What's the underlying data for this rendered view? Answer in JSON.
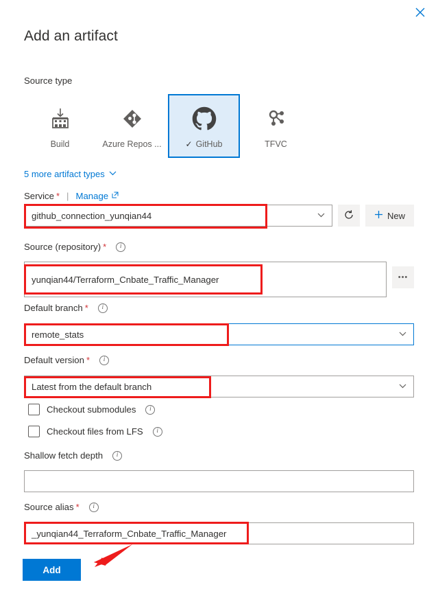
{
  "dialog": {
    "title": "Add an artifact",
    "close_label": "✕"
  },
  "source_type": {
    "label": "Source type",
    "tiles": [
      {
        "label": "Build",
        "icon": "build-icon",
        "selected": false
      },
      {
        "label": "Azure Repos ...",
        "icon": "azure-repos-icon",
        "selected": false
      },
      {
        "label": "GitHub",
        "icon": "github-icon",
        "selected": true
      },
      {
        "label": "TFVC",
        "icon": "tfvc-icon",
        "selected": false
      }
    ],
    "more_types_link": "5 more artifact types",
    "more_types_chevron": "⌄"
  },
  "service": {
    "label": "Service",
    "required_mark": "*",
    "separator": "|",
    "manage_label": "Manage",
    "external_icon": "↗",
    "value": "github_connection_yunqian44",
    "chevron": "⌄",
    "refresh_label": "↻",
    "new_label": "New",
    "new_plus": "+"
  },
  "source_repository": {
    "label": "Source (repository)",
    "required_mark": "*",
    "info": "i",
    "value": "yunqian44/Terraform_Cnbate_Traffic_Manager",
    "browse_label": "•••"
  },
  "default_branch": {
    "label": "Default branch",
    "required_mark": "*",
    "info": "i",
    "value": "remote_stats",
    "chevron": "⌄"
  },
  "default_version": {
    "label": "Default version",
    "required_mark": "*",
    "info": "i",
    "value": "Latest from the default branch",
    "chevron": "⌄"
  },
  "checkboxes": [
    {
      "label": "Checkout submodules",
      "checked": false,
      "info": "i"
    },
    {
      "label": "Checkout files from LFS",
      "checked": false,
      "info": "i"
    }
  ],
  "shallow_fetch_depth": {
    "label": "Shallow fetch depth",
    "info": "i",
    "value": "",
    "placeholder": ""
  },
  "source_alias": {
    "label": "Source alias",
    "required_mark": "*",
    "info": "i",
    "value": "_yunqian44_Terraform_Cnbate_Traffic_Manager"
  },
  "actions": {
    "add_label": "Add"
  },
  "colors": {
    "accent": "#0078d4",
    "annotation": "#ee1c1c",
    "selected_tile_bg": "#deecf9",
    "required": "#d13438"
  }
}
